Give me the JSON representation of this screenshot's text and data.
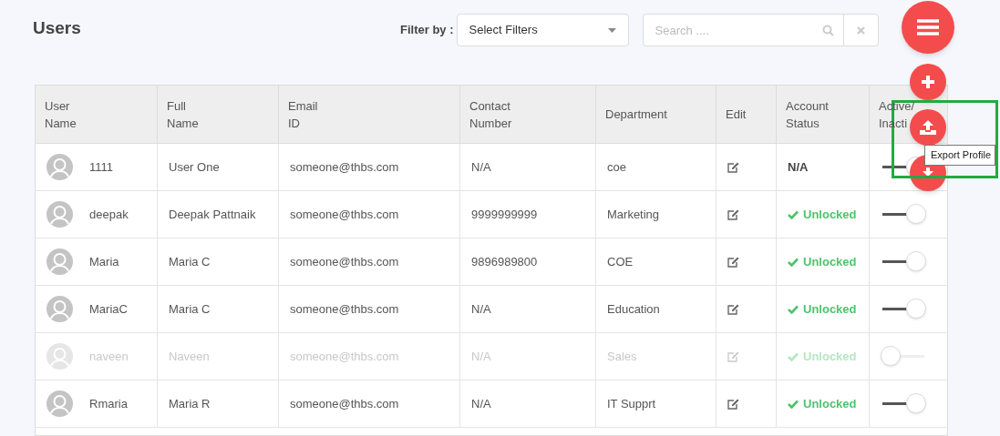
{
  "page_title": "Users",
  "filter": {
    "label": "Filter by :",
    "value": "Select Filters"
  },
  "search": {
    "placeholder": "Search ...."
  },
  "table": {
    "columns": [
      "User Name",
      "Full Name",
      "Email ID",
      "Contact Number",
      "Department",
      "Edit",
      "Account Status",
      "Active/ Inacti"
    ],
    "rows": [
      {
        "user_name": "1111",
        "full_name": "User One",
        "email": "someone@thbs.com",
        "contact": "N/A",
        "department": "coe",
        "status_check": false,
        "status": "N/A",
        "active": true,
        "disabled": false
      },
      {
        "user_name": "deepak",
        "full_name": "Deepak Pattnaik",
        "email": "someone@thbs.com",
        "contact": "9999999999",
        "department": "Marketing",
        "status_check": true,
        "status": "Unlocked",
        "active": true,
        "disabled": false
      },
      {
        "user_name": "Maria",
        "full_name": "Maria C",
        "email": "someone@thbs.com",
        "contact": "9896989800",
        "department": "COE",
        "status_check": true,
        "status": "Unlocked",
        "active": true,
        "disabled": false
      },
      {
        "user_name": "MariaC",
        "full_name": "Maria C",
        "email": "someone@thbs.com",
        "contact": "N/A",
        "department": "Education",
        "status_check": true,
        "status": "Unlocked",
        "active": true,
        "disabled": false
      },
      {
        "user_name": "naveen",
        "full_name": "Naveen",
        "email": "someone@thbs.com",
        "contact": "N/A",
        "department": "Sales",
        "status_check": true,
        "status": "Unlocked",
        "active": false,
        "disabled": true
      },
      {
        "user_name": "Rmaria",
        "full_name": "Maria R",
        "email": "someone@thbs.com",
        "contact": "N/A",
        "department": "IT Supprt",
        "status_check": true,
        "status": "Unlocked",
        "active": true,
        "disabled": false
      }
    ]
  },
  "tooltip": "Export Profile"
}
